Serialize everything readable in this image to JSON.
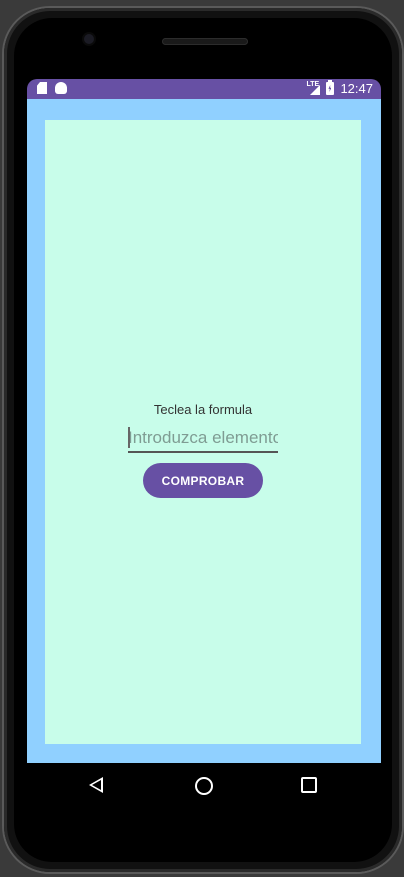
{
  "status_bar": {
    "time": "12:47",
    "network": "LTE",
    "left_icons": [
      "sd-card-icon",
      "android-icon"
    ],
    "right_icons": [
      "signal-icon",
      "battery-icon"
    ],
    "color": "#6750a4"
  },
  "screen": {
    "frame_color": "#90d0ff",
    "background_color": "#c8fdea"
  },
  "form": {
    "label": "Teclea la formula",
    "input_placeholder": "Introduzca elemento",
    "input_value": "",
    "button_label": "COMPROBAR"
  },
  "navigation": {
    "icons": [
      "back-icon",
      "home-icon",
      "recent-apps-icon"
    ]
  }
}
